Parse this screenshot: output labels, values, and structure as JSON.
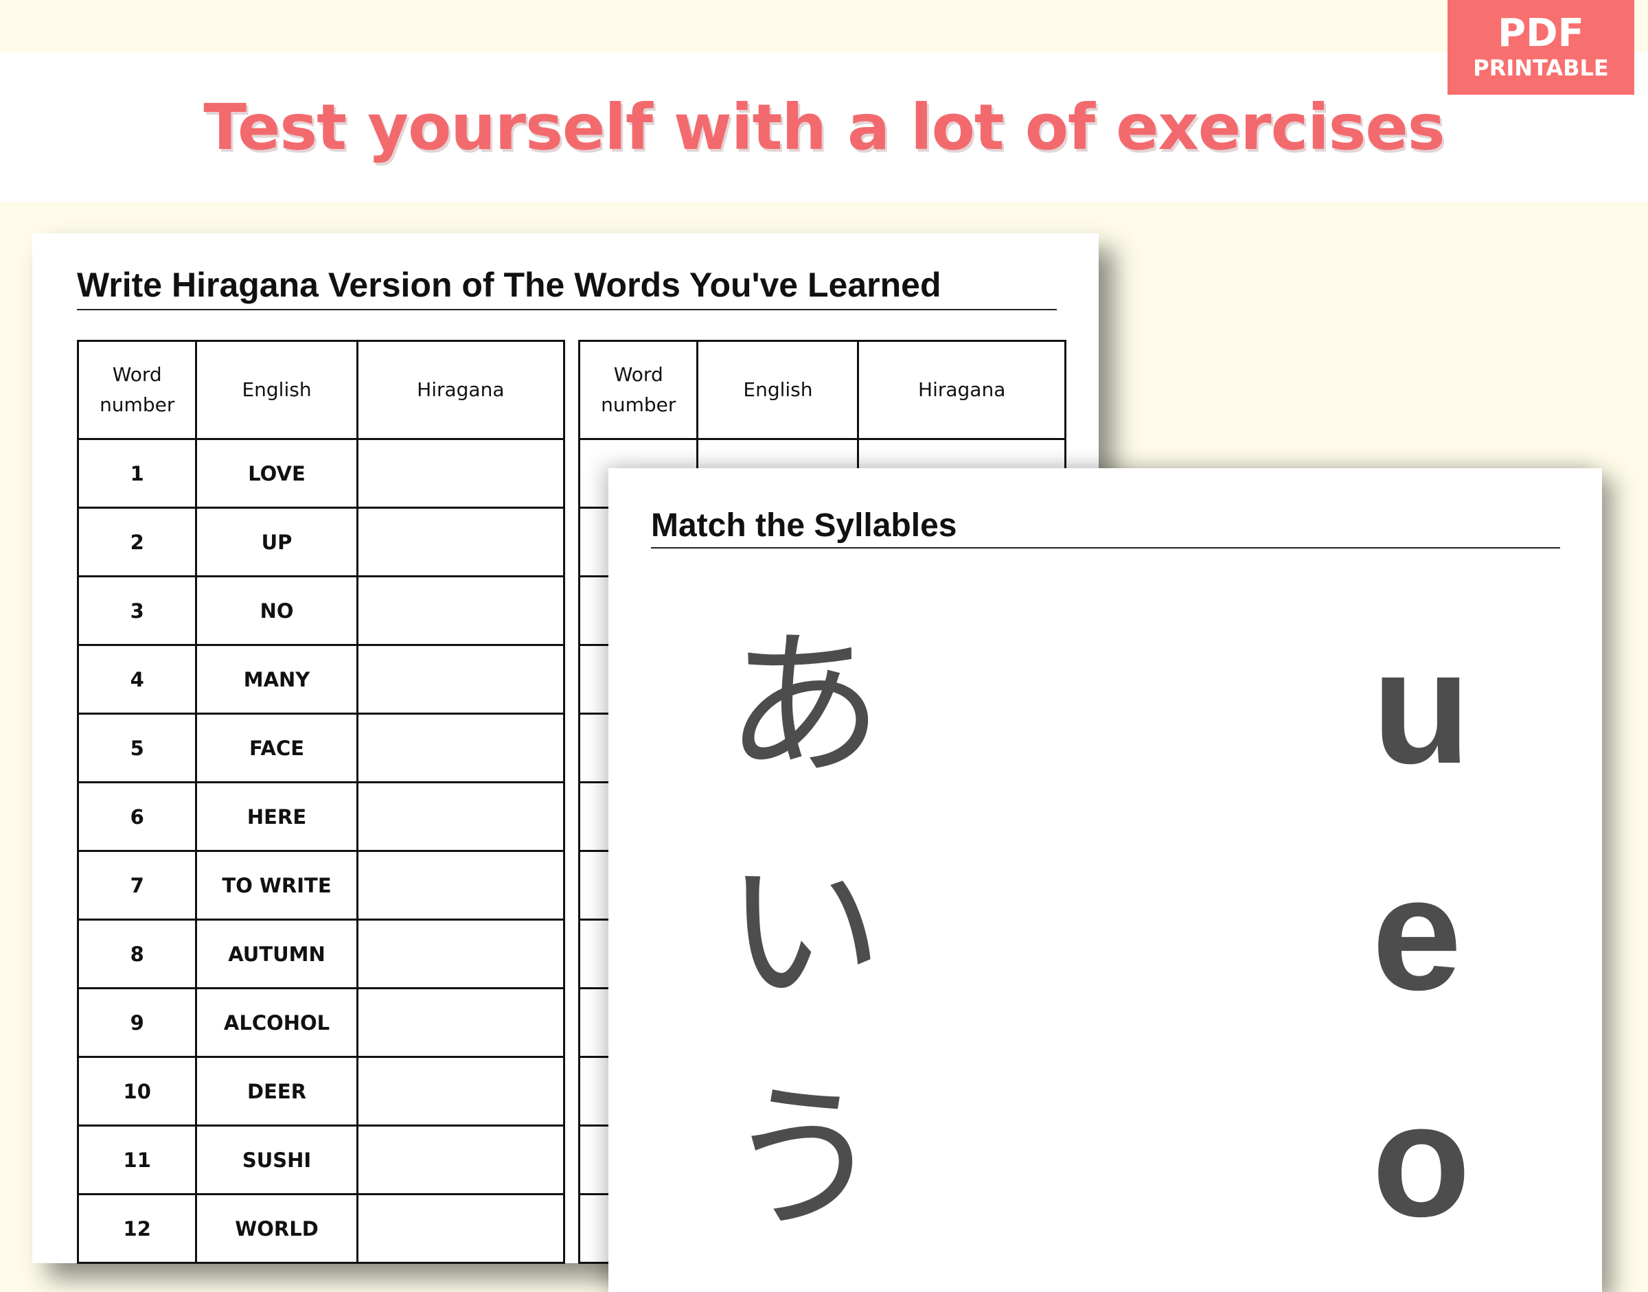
{
  "header": {
    "headline": "Test yourself with a lot of exercises",
    "badge_line1": "PDF",
    "badge_line2": "PRINTABLE"
  },
  "worksheet1": {
    "title": "Write Hiragana Version of The Words You've Learned",
    "columns": [
      "Word number",
      "English",
      "Hiragana"
    ],
    "rows": [
      {
        "number": "1",
        "english": "LOVE",
        "hiragana": ""
      },
      {
        "number": "2",
        "english": "UP",
        "hiragana": ""
      },
      {
        "number": "3",
        "english": "NO",
        "hiragana": ""
      },
      {
        "number": "4",
        "english": "MANY",
        "hiragana": ""
      },
      {
        "number": "5",
        "english": "FACE",
        "hiragana": ""
      },
      {
        "number": "6",
        "english": "HERE",
        "hiragana": ""
      },
      {
        "number": "7",
        "english": "TO WRITE",
        "hiragana": ""
      },
      {
        "number": "8",
        "english": "AUTUMN",
        "hiragana": ""
      },
      {
        "number": "9",
        "english": "ALCOHOL",
        "hiragana": ""
      },
      {
        "number": "10",
        "english": "DEER",
        "hiragana": ""
      },
      {
        "number": "11",
        "english": "SUSHI",
        "hiragana": ""
      },
      {
        "number": "12",
        "english": "WORLD",
        "hiragana": ""
      }
    ],
    "right_columns": [
      "Word number",
      "English",
      "Hiragana"
    ]
  },
  "worksheet2": {
    "title": "Match the Syllables",
    "hiragana": [
      "あ",
      "い",
      "う"
    ],
    "romaji": [
      "u",
      "e",
      "o"
    ]
  }
}
